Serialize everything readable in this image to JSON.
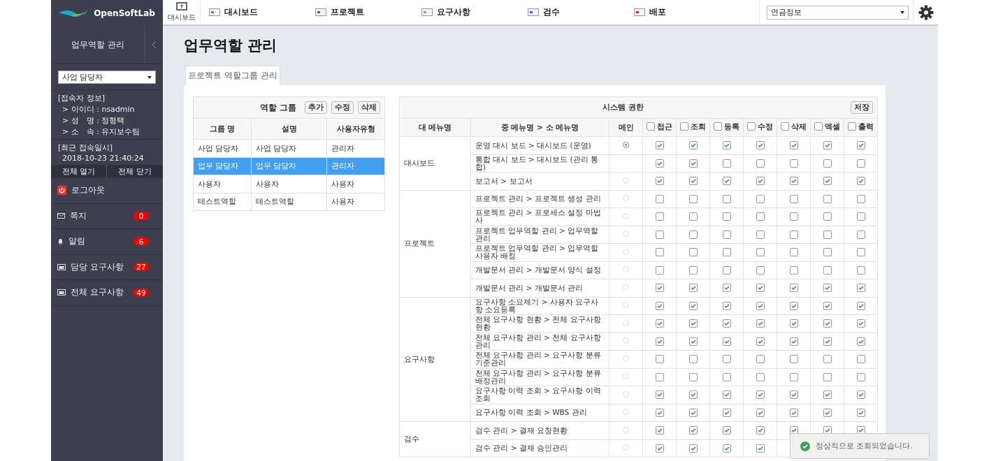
{
  "header": {
    "logo": "OpenSoftLab",
    "home_label": "대시보드",
    "nav": [
      {
        "label": "대시보드",
        "kind": "dashboard"
      },
      {
        "label": "프로젝트",
        "kind": "project"
      },
      {
        "label": "요구사항",
        "kind": "requirement"
      },
      {
        "label": "검수",
        "kind": "inspection"
      },
      {
        "label": "배포",
        "kind": "deploy"
      }
    ],
    "project_select": "연금정보"
  },
  "sidebar": {
    "title": "업무역할 관리",
    "role_select": "사업 담당자",
    "user_info": {
      "heading": "[접속자 정보]",
      "lines": [
        "> 아이디 : nsadmin",
        "> 성　명 : 정형택",
        "> 소　속 : 유지보수팀"
      ]
    },
    "last_login": {
      "heading": "[최근 접속일시]",
      "value": "2018-10-23 21:40:24"
    },
    "toggle_buttons": [
      "전체 열기",
      "전체 닫기"
    ],
    "menu": [
      {
        "label": "로그아웃",
        "kind": "logout"
      },
      {
        "label": "쪽지",
        "kind": "mail",
        "count": "0"
      },
      {
        "label": "알림",
        "kind": "bell",
        "count": "6"
      },
      {
        "label": "담당 요구사항",
        "kind": "assigned",
        "count": "27"
      },
      {
        "label": "전체 요구사항",
        "kind": "all",
        "count": "49"
      }
    ]
  },
  "page_title": "업무역할 관리",
  "tabs": [
    {
      "label": "프로젝트 역할그룹 관리",
      "selected": true
    }
  ],
  "role_groups": {
    "title": "역할 그룹",
    "buttons": [
      "추가",
      "수정",
      "삭제"
    ],
    "columns": [
      "그룹 명",
      "설명",
      "사용자유형"
    ],
    "rows": [
      {
        "cells": [
          "사업 담당자",
          "사업 담당자",
          "관리자"
        ],
        "selected": false
      },
      {
        "cells": [
          "업무 담당자",
          "업무 담당자",
          "관리자"
        ],
        "selected": true
      },
      {
        "cells": [
          "사용자",
          "사용자",
          "사용자"
        ],
        "selected": false
      },
      {
        "cells": [
          "테스트역할",
          "테스트역할",
          "사용자"
        ],
        "selected": false
      }
    ]
  },
  "permissions": {
    "title": "시스템 권한",
    "save_button": "저장",
    "columns": [
      "대 메뉴명",
      "중 메뉴명 > 소 메뉴명",
      "메인"
    ],
    "check_columns": [
      {
        "label": "접근",
        "checked": false
      },
      {
        "label": "조회",
        "checked": false
      },
      {
        "label": "등록",
        "checked": false
      },
      {
        "label": "수정",
        "checked": false
      },
      {
        "label": "삭제",
        "checked": false
      },
      {
        "label": "엑셀",
        "checked": false
      },
      {
        "label": "출력",
        "checked": false
      }
    ],
    "groups": [
      {
        "name": "대시보드",
        "rows": [
          {
            "menu": "운영 대시 보드 > 대시보드 (운영)",
            "main": true,
            "checks": [
              true,
              true,
              true,
              true,
              true,
              true,
              true
            ]
          },
          {
            "menu": "통합 대시 보드 > 대시보드 (관리 통합)",
            "checks": [
              true,
              true,
              false,
              false,
              false,
              false,
              false
            ]
          },
          {
            "menu": "보고서 > 보고서",
            "main": false,
            "checks": [
              true,
              true,
              true,
              true,
              true,
              true,
              true
            ]
          }
        ]
      },
      {
        "name": "프로젝트",
        "rows": [
          {
            "menu": "프로젝트 관리 > 프로젝트 생성 관리",
            "main": false,
            "checks": [
              false,
              false,
              false,
              false,
              false,
              false,
              false
            ]
          },
          {
            "menu": "프로젝트 관리 > 프로세스 설정 마법사",
            "main": false,
            "checks": [
              false,
              false,
              false,
              false,
              false,
              false,
              false
            ]
          },
          {
            "menu": "프로젝트 업무역할 관리 > 업무역할 관리",
            "main": false,
            "checks": [
              false,
              false,
              false,
              false,
              false,
              false,
              false
            ]
          },
          {
            "menu": "프로젝트 업무역할 관리 > 업무역할 사용자 배정",
            "main": false,
            "checks": [
              false,
              false,
              false,
              false,
              false,
              false,
              false
            ]
          },
          {
            "menu": "개발문서 관리 > 개발문서 양식 설정",
            "main": false,
            "checks": [
              false,
              false,
              false,
              false,
              false,
              false,
              false
            ]
          },
          {
            "menu": "개발문서 관리 > 개발문서 관리",
            "main": false,
            "checks": [
              true,
              true,
              true,
              true,
              true,
              true,
              true
            ]
          }
        ]
      },
      {
        "name": "요구사항",
        "rows": [
          {
            "menu": "요구사항 소요제기 > 사용자 요구사항 소요등록",
            "main": false,
            "checks": [
              true,
              true,
              true,
              true,
              true,
              true,
              true
            ]
          },
          {
            "menu": "전체 요구사항 현황 > 전체 요구사항 현황",
            "main": false,
            "checks": [
              true,
              true,
              true,
              true,
              true,
              true,
              true
            ]
          },
          {
            "menu": "전체 요구사항 관리 > 전체 요구사항 관리",
            "main": false,
            "checks": [
              true,
              true,
              true,
              true,
              true,
              true,
              true
            ]
          },
          {
            "menu": "전체 요구사항 관리 > 요구사항 분류 기준관리",
            "main": false,
            "checks": [
              false,
              false,
              false,
              false,
              false,
              false,
              false
            ]
          },
          {
            "menu": "전체 요구사항 관리 > 요구사항 분류 배정관리",
            "main": false,
            "checks": [
              false,
              false,
              false,
              false,
              false,
              false,
              false
            ]
          },
          {
            "menu": "요구사항 이력 조회 > 요구사항 이력 조회",
            "main": false,
            "checks": [
              true,
              true,
              true,
              true,
              true,
              true,
              true
            ]
          },
          {
            "menu": "요구사항 이력 조회 > WBS 관리",
            "main": false,
            "checks": [
              true,
              true,
              true,
              true,
              true,
              true,
              true
            ]
          }
        ]
      },
      {
        "name": "검수",
        "rows": [
          {
            "menu": "검수 관리 > 결재 요청현황",
            "main": false,
            "checks": [
              true,
              true,
              true,
              true,
              true,
              true,
              true
            ]
          },
          {
            "menu": "검수 관리 > 결재 승인관리",
            "main": false,
            "checks": [
              true,
              true,
              true,
              true
            ]
          }
        ]
      }
    ]
  },
  "toast": {
    "message": "정상적으로 조회되었습니다."
  }
}
